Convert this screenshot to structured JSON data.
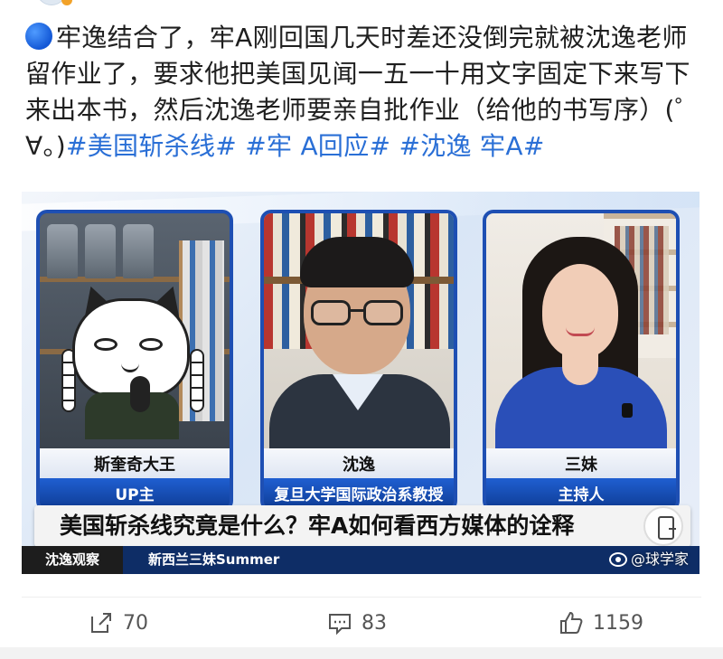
{
  "post": {
    "text_main": "牢逸结合了，牢A刚回国几天时差还没倒完就被沈逸老师留作业了，要求他把美国见闻一五一十用文字固定下来写下来出本书，然后沈逸老师要亲自批作业（给他的书写序）(゜∀。)",
    "tags": [
      "#美国斩杀线#",
      "#牢 A回应#",
      "#沈逸 牢A#"
    ]
  },
  "video": {
    "panels": [
      {
        "name": "斯奎奇大王",
        "role": "UP主"
      },
      {
        "name": "沈逸",
        "role": "复旦大学国际政治系教授"
      },
      {
        "name": "三妹",
        "role": "主持人"
      }
    ],
    "headline": "美国斩杀线究竟是什么？牢A如何看西方媒体的诠释",
    "strip_left": "沈逸观察",
    "strip_mid": "新西兰三妹Summer",
    "watermark": "@球学家"
  },
  "actions": {
    "share_count": "70",
    "comment_count": "83",
    "like_count": "1159"
  },
  "colors": {
    "tag": "#2a6fd6",
    "panel_border": "#1e4fb3",
    "role_bar": "#1f5fd1"
  },
  "icons": [
    "share-icon",
    "comment-icon",
    "like-icon",
    "phone-icon",
    "weibo-icon",
    "blue-dot-icon"
  ]
}
